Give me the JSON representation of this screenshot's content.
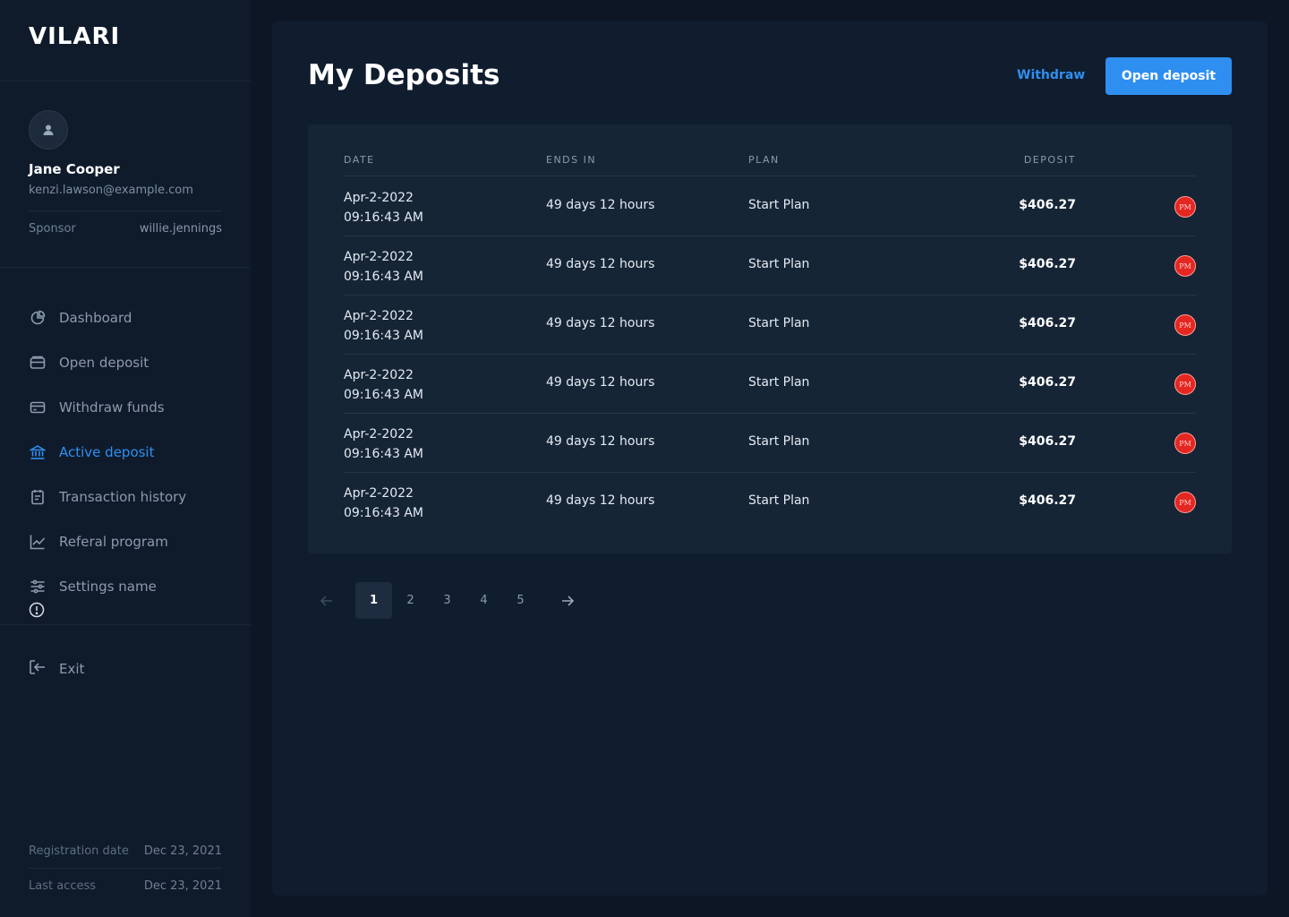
{
  "brand": "VILARI",
  "user": {
    "name": "Jane Cooper",
    "email": "kenzi.lawson@example.com",
    "sponsor_label": "Sponsor",
    "sponsor_value": "willie.jennings"
  },
  "nav": [
    {
      "label": "Dashboard",
      "icon": "pie-chart-icon"
    },
    {
      "label": "Open deposit",
      "icon": "wallet-icon"
    },
    {
      "label": "Withdraw funds",
      "icon": "credit-card-icon"
    },
    {
      "label": "Active deposit",
      "icon": "bank-icon",
      "active": true
    },
    {
      "label": "Transaction history",
      "icon": "clipboard-icon"
    },
    {
      "label": "Referal program",
      "icon": "trend-chart-icon"
    },
    {
      "label": "Settings name",
      "icon": "sliders-icon"
    }
  ],
  "exit_label": "Exit",
  "meta": {
    "registration_label": "Registration date",
    "registration_value": "Dec 23, 2021",
    "last_access_label": "Last access",
    "last_access_value": "Dec 23, 2021"
  },
  "main": {
    "title": "My Deposits",
    "withdraw_label": "Withdraw",
    "open_deposit_label": "Open deposit"
  },
  "table": {
    "headers": {
      "date": "DATE",
      "ends": "ENDS IN",
      "plan": "PLAN",
      "deposit": "DEPOSIT"
    },
    "rows": [
      {
        "date": "Apr-2-2022",
        "time": "09:16:43 AM",
        "ends": "49 days 12 hours",
        "plan": "Start Plan",
        "amount": "$406.27",
        "badge": "PM"
      },
      {
        "date": "Apr-2-2022",
        "time": "09:16:43 AM",
        "ends": "49 days 12 hours",
        "plan": "Start Plan",
        "amount": "$406.27",
        "badge": "PM"
      },
      {
        "date": "Apr-2-2022",
        "time": "09:16:43 AM",
        "ends": "49 days 12 hours",
        "plan": "Start Plan",
        "amount": "$406.27",
        "badge": "PM"
      },
      {
        "date": "Apr-2-2022",
        "time": "09:16:43 AM",
        "ends": "49 days 12 hours",
        "plan": "Start Plan",
        "amount": "$406.27",
        "badge": "PM"
      },
      {
        "date": "Apr-2-2022",
        "time": "09:16:43 AM",
        "ends": "49 days 12 hours",
        "plan": "Start Plan",
        "amount": "$406.27",
        "badge": "PM"
      },
      {
        "date": "Apr-2-2022",
        "time": "09:16:43 AM",
        "ends": "49 days 12 hours",
        "plan": "Start Plan",
        "amount": "$406.27",
        "badge": "PM"
      }
    ]
  },
  "pagination": {
    "pages": [
      "1",
      "2",
      "3",
      "4",
      "5"
    ],
    "current": "1"
  },
  "colors": {
    "accent": "#2f8ff0",
    "pm_badge": "#e52722",
    "background": "#0c1624",
    "panel": "#101d2e",
    "card": "#162536"
  }
}
